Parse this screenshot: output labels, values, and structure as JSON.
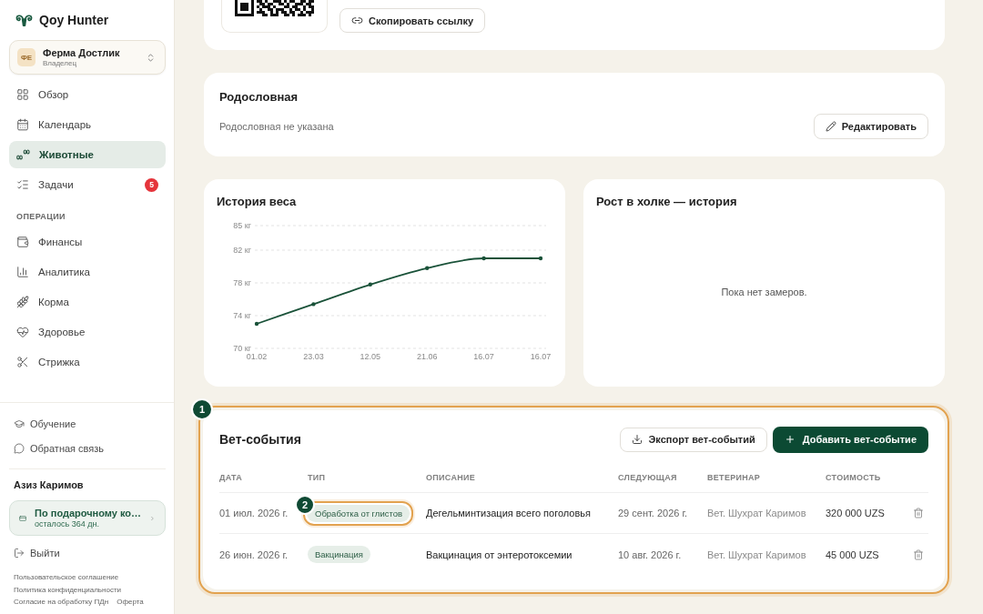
{
  "sidebar": {
    "brand": "Qoy Hunter",
    "farm": {
      "initials": "ФЕ",
      "name": "Ферма Достлик",
      "role": "Владелец"
    },
    "main_items": [
      {
        "label": "Обзор",
        "selected": false
      },
      {
        "label": "Календарь",
        "selected": false
      },
      {
        "label": "Животные",
        "selected": true
      },
      {
        "label": "Задачи",
        "selected": false,
        "badge": "5"
      }
    ],
    "section_title": "ОПЕРАЦИИ",
    "operation_items": [
      {
        "label": "Финансы",
        "selected": false
      },
      {
        "label": "Аналитика",
        "selected": false
      },
      {
        "label": "Корма",
        "selected": false
      },
      {
        "label": "Здоровье",
        "selected": false
      },
      {
        "label": "Стрижка",
        "selected": false
      }
    ],
    "help_links": [
      "Обучение",
      "Обратная связь"
    ],
    "user_name": "Азиз Каримов",
    "subscription": {
      "title": "По подарочному ко…",
      "subtitle": "осталось 364 дн."
    },
    "logout": "Выйти",
    "legal_link_rows": [
      [
        "Пользовательское соглашение"
      ],
      [
        "Политика конфиденциальности"
      ],
      [
        "Согласие на обработку ПДн",
        "Оферта"
      ]
    ]
  },
  "share_card": {
    "copy_link_button": "Скопировать ссылку"
  },
  "pedigree": {
    "title": "Родословная",
    "empty_text": "Родословная не указана",
    "edit_button": "Редактировать"
  },
  "weight_history": {
    "title": "История веса",
    "chart_data": {
      "type": "line",
      "categories": [
        "01.02",
        "23.03",
        "12.05",
        "21.06",
        "16.07",
        "16.07"
      ],
      "values": [
        73,
        75.4,
        77.8,
        79.8,
        81,
        81
      ],
      "ylim": [
        70,
        85
      ],
      "yticks": [
        {
          "value": 70,
          "label": "70 кг"
        },
        {
          "value": 74,
          "label": "74 кг"
        },
        {
          "value": 78,
          "label": "78 кг"
        },
        {
          "value": 82,
          "label": "82 кг"
        },
        {
          "value": 85,
          "label": "85 кг"
        }
      ],
      "grid": true
    }
  },
  "height_history": {
    "title": "Рост в холке — история",
    "empty_text": "Пока нет замеров."
  },
  "vet_events": {
    "marker": "1",
    "title": "Вет-события",
    "export_button": "Экспорт вет-событий",
    "add_button": "Добавить вет-событие",
    "columns": [
      "ДАТА",
      "ТИП",
      "ОПИСАНИЕ",
      "СЛЕДУЮЩАЯ",
      "ВЕТЕРИНАР",
      "СТОИМОСТЬ"
    ],
    "rows": [
      {
        "date": "01 июл. 2026 г.",
        "type": "Обработка от глистов",
        "type_marker": "2",
        "description": "Дегельминтизация всего поголовья",
        "next": "29 сент. 2026 г.",
        "vet": "Вет. Шухрат Каримов",
        "cost": "320 000 UZS"
      },
      {
        "date": "26 июн. 2026 г.",
        "type": "Вакцинация",
        "description": "Вакцинация от энтеротоксемии",
        "next": "10 авг. 2026 г.",
        "vet": "Вет. Шухрат Каримов",
        "cost": "45 000 UZS"
      }
    ]
  }
}
